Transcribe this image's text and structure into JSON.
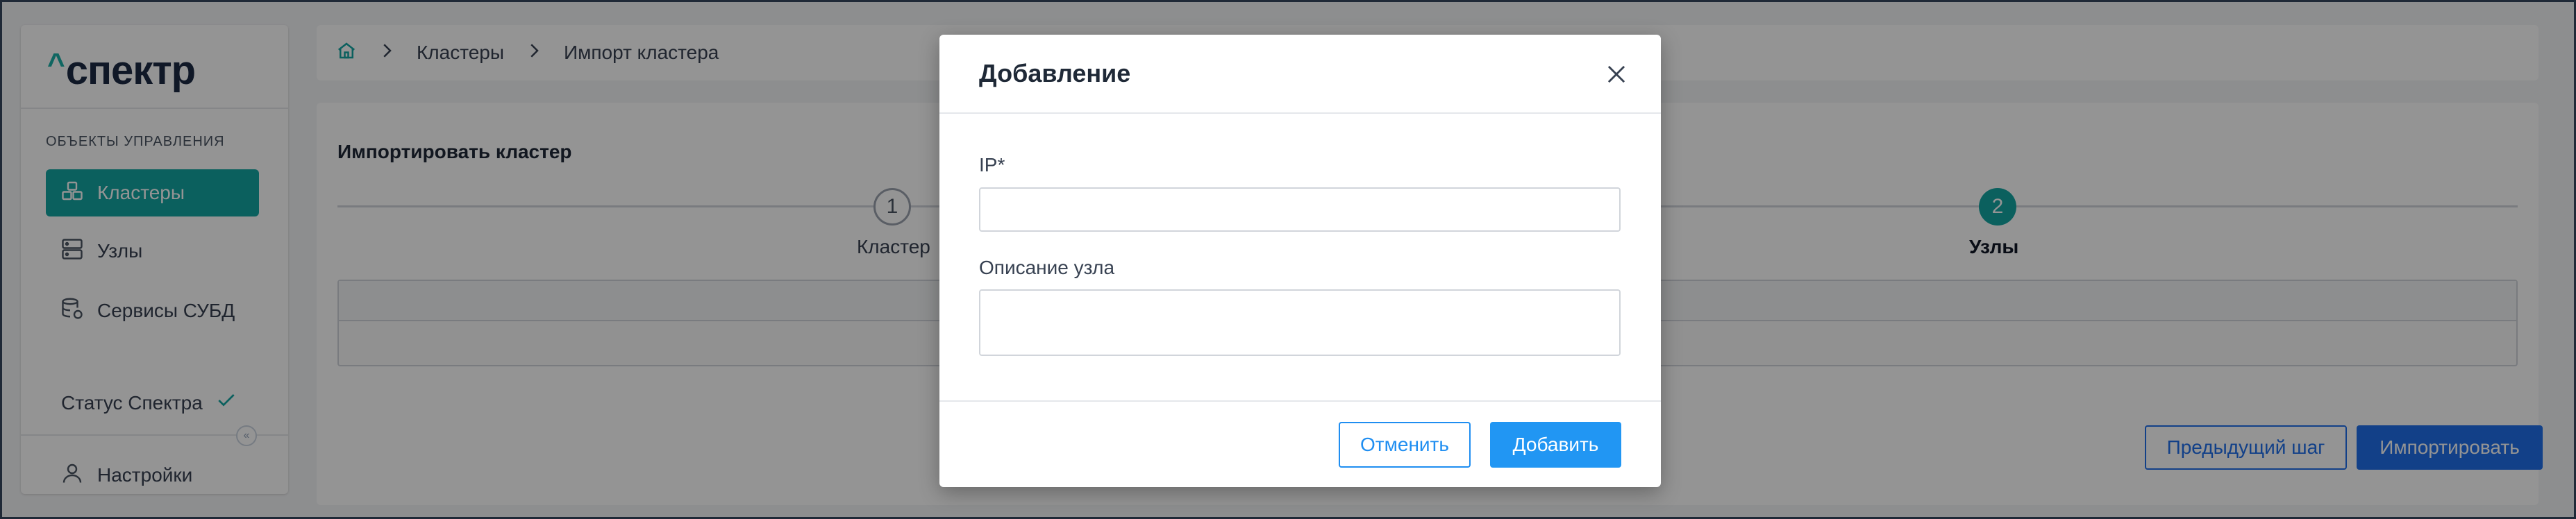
{
  "app": {
    "logo": "спектр"
  },
  "sidebar": {
    "section_title": "ОБЪЕКТЫ УПРАВЛЕНИЯ",
    "items": [
      {
        "label": "Кластеры",
        "icon": "clusters-icon",
        "active": true
      },
      {
        "label": "Узлы",
        "icon": "server-icon",
        "active": false
      },
      {
        "label": "Сервисы СУБД",
        "icon": "database-icon",
        "active": false
      }
    ],
    "status_label": "Статус Спектра",
    "settings_label": "Настройки"
  },
  "breadcrumb": {
    "items": [
      "Кластеры",
      "Импорт кластера"
    ]
  },
  "main": {
    "title": "Импортировать кластер",
    "steps": [
      {
        "number": "1",
        "label": "Кластер"
      },
      {
        "number": "2",
        "label": "Узлы"
      }
    ],
    "prev_button": "Предыдущий шаг",
    "import_button": "Импортировать"
  },
  "modal": {
    "title": "Добавление",
    "ip_label": "IP*",
    "ip_value": "",
    "description_label": "Описание узла",
    "description_value": "",
    "cancel_button": "Отменить",
    "add_button": "Добавить"
  },
  "colors": {
    "accent_teal": "#14a5a3",
    "primary_blue": "#2196f3",
    "logo_dark": "#1d2a44"
  }
}
